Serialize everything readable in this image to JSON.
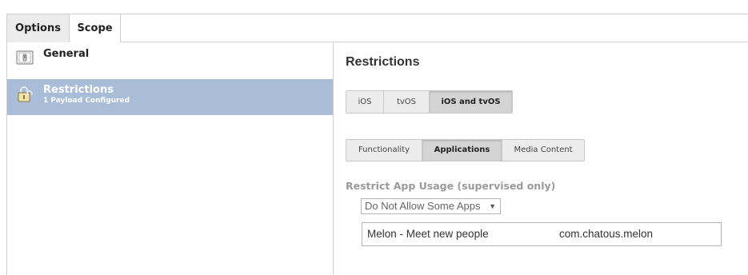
{
  "top_tabs": [
    {
      "label": "Options",
      "active": true
    },
    {
      "label": "Scope",
      "active": false
    }
  ],
  "payloads": [
    {
      "title": "General",
      "subtitle": "",
      "icon": "switch-icon",
      "selected": false
    },
    {
      "title": "Restrictions",
      "subtitle": "1 Payload Configured",
      "icon": "padlock-icon",
      "selected": true
    }
  ],
  "section_title": "Restrictions",
  "platform_tabs": [
    {
      "label": "iOS",
      "active": false
    },
    {
      "label": "tvOS",
      "active": false
    },
    {
      "label": "iOS and tvOS",
      "active": true
    }
  ],
  "sub_tabs": [
    {
      "label": "Functionality",
      "active": false
    },
    {
      "label": "Applications",
      "active": true
    },
    {
      "label": "Media Content",
      "active": false
    }
  ],
  "restrict_app_usage": {
    "label": "Restrict App Usage (supervised only)",
    "selected_option": "Do Not Allow Some Apps",
    "apps": [
      {
        "name": "Melon - Meet new people",
        "bundle_id": "com.chatous.melon"
      }
    ]
  },
  "colors": {
    "selected_row": "#a9bcd8",
    "border": "#cfcfcf",
    "disabled_label": "#9a9a9a"
  }
}
